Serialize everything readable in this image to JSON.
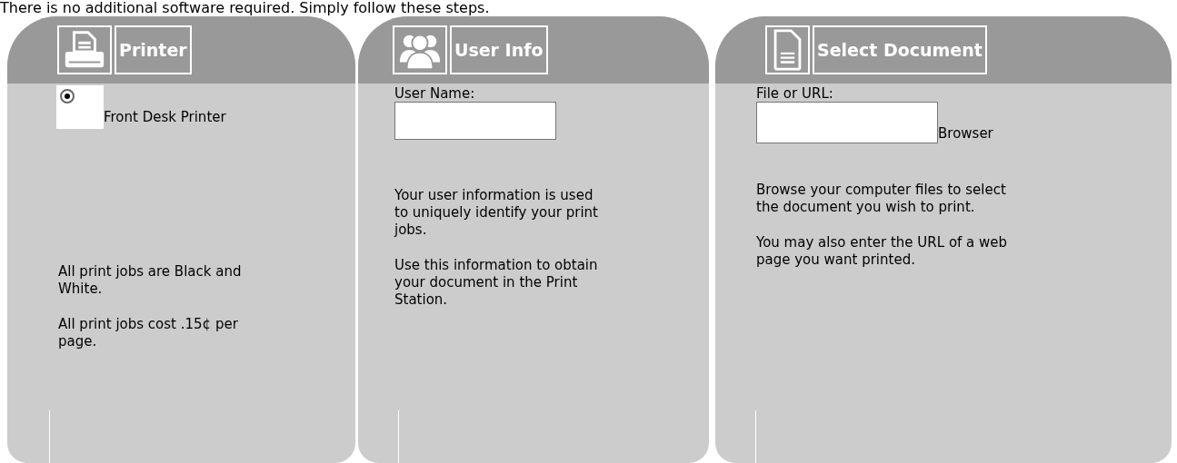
{
  "intro": "There is no additional software required. Simply follow these steps.",
  "panels": [
    {
      "kind": "printer",
      "title": "Printer",
      "options": [
        {
          "label": "Front Desk Printer",
          "selected": true
        }
      ],
      "paragraphs": [
        "All print jobs are Black and White.",
        "All print jobs cost .15¢ per page."
      ]
    },
    {
      "kind": "user",
      "title": "User Info",
      "field_label": "User Name:",
      "paragraphs": [
        "Your user information is used to uniquely identify your print jobs.",
        "Use this information to obtain your document in the Print Station."
      ]
    },
    {
      "kind": "document",
      "title": "Select Document",
      "field_label": "File or URL:",
      "browse_label": "Browser",
      "paragraphs": [
        "Browse your computer files to select the document you wish to print.",
        "You may also enter the URL of a web page you want printed."
      ]
    }
  ]
}
